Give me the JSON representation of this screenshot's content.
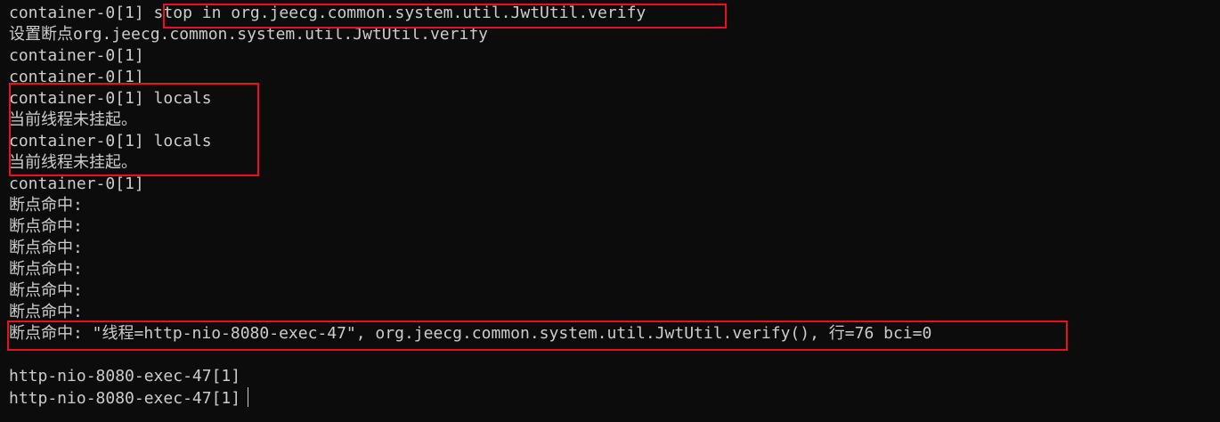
{
  "terminal": {
    "lines": [
      "container-0[1] stop in org.jeecg.common.system.util.JwtUtil.verify",
      "设置断点org.jeecg.common.system.util.JwtUtil.verify",
      "container-0[1]",
      "container-0[1]",
      "container-0[1] locals",
      "当前线程未挂起。",
      "container-0[1] locals",
      "当前线程未挂起。",
      "container-0[1]",
      "断点命中:",
      "断点命中:",
      "断点命中:",
      "断点命中:",
      "断点命中:",
      "断点命中:",
      "断点命中: \"线程=http-nio-8080-exec-47\", org.jeecg.common.system.util.JwtUtil.verify(), 行=76 bci=0",
      "",
      "http-nio-8080-exec-47[1]",
      "http-nio-8080-exec-47[1]"
    ]
  },
  "colors": {
    "background": "#0c0c0c",
    "text": "#cccccc",
    "highlight_border": "#e81123"
  }
}
